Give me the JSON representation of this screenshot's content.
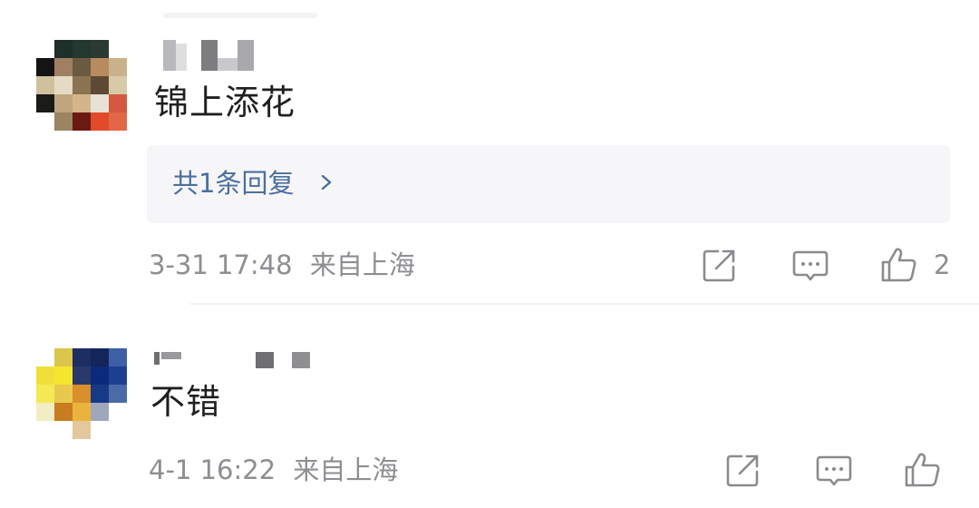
{
  "comments": [
    {
      "text": "锦上添花",
      "replies_label": "共1条回复",
      "date": "3-31 17:48",
      "location": "来自上海",
      "like_count": "2",
      "actions": {
        "forward_icon": "share-icon",
        "comment_icon": "comment-icon",
        "like_icon": "thumbs-up-icon"
      }
    },
    {
      "text": "不错",
      "date": "4-1 16:22",
      "location": "来自上海",
      "actions": {
        "forward_icon": "share-icon",
        "comment_icon": "comment-icon",
        "like_icon": "thumbs-up-icon"
      }
    }
  ],
  "colors": {
    "reply_link": "#4b6f9e",
    "meta_text": "#8d8d92",
    "reply_box_bg": "#f6f6f8",
    "icon_stroke": "#8a8a8f"
  }
}
